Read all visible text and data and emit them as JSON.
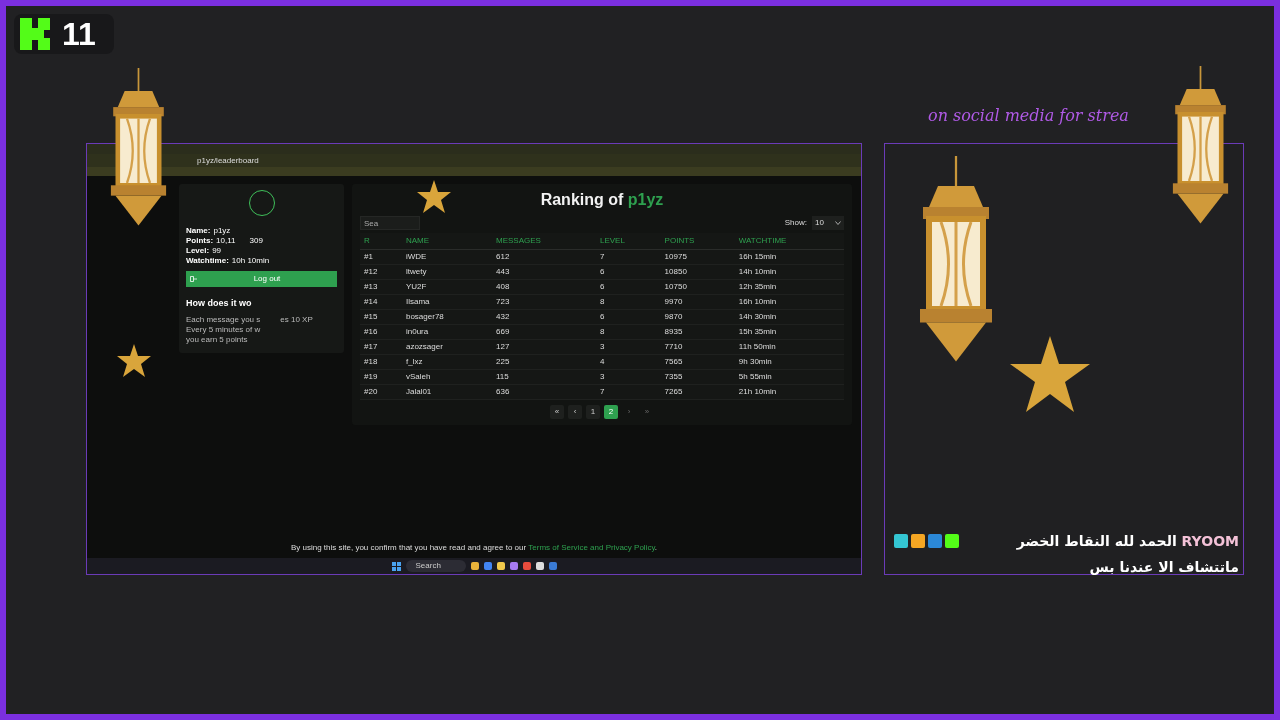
{
  "viewer_badge": {
    "count": "11"
  },
  "browser": {
    "url": "p1yz/leaderboard"
  },
  "profile": {
    "lines": [
      {
        "label": "Name:",
        "parts": [
          "p1yz"
        ]
      },
      {
        "label": "Points:",
        "parts": [
          "10,11",
          "309"
        ]
      },
      {
        "label": "Level:",
        "parts": [
          "99"
        ]
      },
      {
        "label": "Watchtime:",
        "parts": [
          "10h 10min"
        ]
      }
    ],
    "logout": "Log out",
    "help_title": "How does it wo",
    "help_lines": [
      [
        "Each message you s",
        "es 10 XP"
      ],
      [
        "Every 5 minutes of w",
        "you earn 5 points"
      ]
    ]
  },
  "leaderboard": {
    "title": "Ranking of",
    "user": "p1yz",
    "search_placeholder": "Sea",
    "show_label": "Show:",
    "show_value": "10",
    "columns": [
      "R",
      "NAME",
      "MESSAGES",
      "LEVEL",
      "POINTS",
      "WATCHTIME"
    ],
    "rows": [
      [
        "#1",
        "iWDE",
        "612",
        "7",
        "10975",
        "16h 15min"
      ],
      [
        "#12",
        "ltwety",
        "443",
        "6",
        "10850",
        "14h 10min"
      ],
      [
        "#13",
        "YU2F",
        "408",
        "6",
        "10750",
        "12h 35min"
      ],
      [
        "#14",
        "Ilsama",
        "723",
        "8",
        "9970",
        "16h 10min"
      ],
      [
        "#15",
        "bosager78",
        "432",
        "6",
        "9870",
        "14h 30min"
      ],
      [
        "#16",
        "in0ura",
        "669",
        "8",
        "8935",
        "15h 35min"
      ],
      [
        "#17",
        "azozsager",
        "127",
        "3",
        "7710",
        "11h 50min"
      ],
      [
        "#18",
        "f_lxz",
        "225",
        "4",
        "7565",
        "9h 30min"
      ],
      [
        "#19",
        "vSaleh",
        "115",
        "3",
        "7355",
        "5h 55min"
      ],
      [
        "#20",
        "Jalal01",
        "636",
        "7",
        "7265",
        "21h 10min"
      ]
    ],
    "pagination": [
      {
        "label": "«",
        "selected": false,
        "disabled": false
      },
      {
        "label": "‹",
        "selected": false,
        "disabled": false
      },
      {
        "label": "1",
        "selected": false,
        "disabled": false
      },
      {
        "label": "2",
        "selected": true,
        "disabled": false
      },
      {
        "label": "›",
        "selected": false,
        "disabled": true
      },
      {
        "label": "»",
        "selected": false,
        "disabled": true
      }
    ]
  },
  "footer": {
    "text": "By using this site, you confirm that you have read and agree to our",
    "link": "Terms of Service and Privacy Policy",
    "end": "."
  },
  "taskbar": {
    "search": "Search"
  },
  "promo": "on social media for strea",
  "chat": {
    "user": "RYOOM",
    "message": "الحمد لله النقاط الخضر ماتتشاف الا عندنا بس"
  }
}
